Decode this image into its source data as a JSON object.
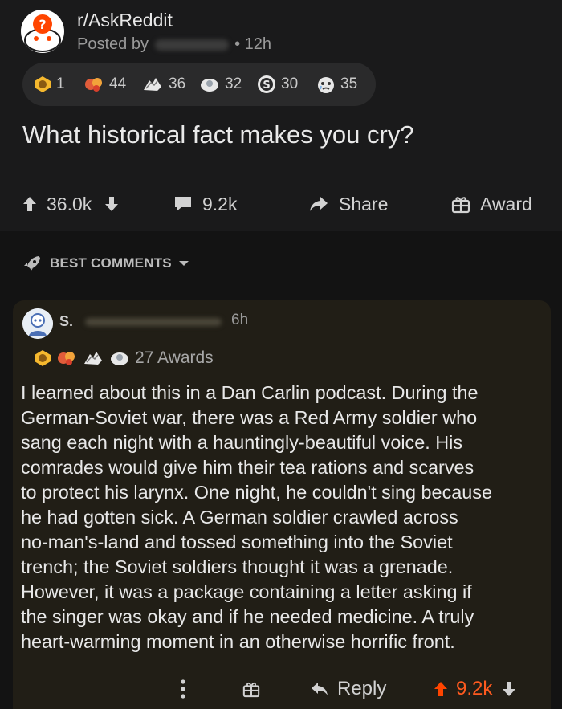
{
  "post": {
    "subreddit": "r/AskReddit",
    "posted_by": "Posted by",
    "time": "• 12h",
    "awards": [
      {
        "icon": "wholesome-award-icon",
        "count": "1"
      },
      {
        "icon": "hugz-award-icon",
        "count": "44"
      },
      {
        "icon": "bravo-award-icon",
        "count": "36"
      },
      {
        "icon": "helpful-award-icon",
        "count": "32"
      },
      {
        "icon": "silver-award-icon",
        "count": "30"
      },
      {
        "icon": "tearful-award-icon",
        "count": "35"
      }
    ],
    "title": "What historical fact makes you cry?",
    "upvotes": "36.0k",
    "comments": "9.2k",
    "share": "Share",
    "award": "Award"
  },
  "sort": {
    "label": "BEST COMMENTS"
  },
  "comment": {
    "user_initial": "S.",
    "time": "6h",
    "awards_text": "27 Awards",
    "body_lines": [
      "I learned about this in a Dan Carlin podcast. During the",
      "German-Soviet war, there was a Red Army soldier who",
      "sang each night with a hauntingly-beautiful voice. His",
      "comrades would give him their tea rations and scarves",
      "to protect his larynx. One night, he couldn't sing because",
      "he had gotten sick. A German soldier crawled across",
      "no-man's-land and tossed something into the Soviet",
      "trench; the Soviet soldiers thought it was a grenade.",
      "However, it was a package containing a letter asking if",
      "the singer was okay and if he needed medicine. A truly",
      "heart-warming moment in an otherwise horrific front."
    ],
    "reply": "Reply",
    "votes": "9.2k"
  },
  "colors": {
    "background": "#131313",
    "card": "#1a1a1b",
    "comment_card": "#211e16",
    "accent": "#ff4500"
  }
}
